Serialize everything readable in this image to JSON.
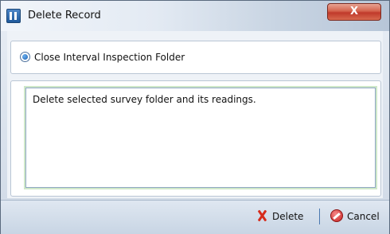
{
  "window": {
    "title": "Delete Record",
    "close_glyph": "X"
  },
  "options": {
    "selected_label": "Close Interval Inspection Folder"
  },
  "message": {
    "text": "Delete selected survey folder and its readings."
  },
  "footer": {
    "delete_label": "Delete",
    "cancel_label": "Cancel"
  },
  "colors": {
    "accent_delete": "#d62b1c",
    "accent_cancel": "#c81f1f",
    "title_bar": "#e3eaf3"
  },
  "icons": {
    "app": "app-icon",
    "delete": "x-icon",
    "cancel": "stop-icon",
    "radio": "radio-selected-icon"
  }
}
